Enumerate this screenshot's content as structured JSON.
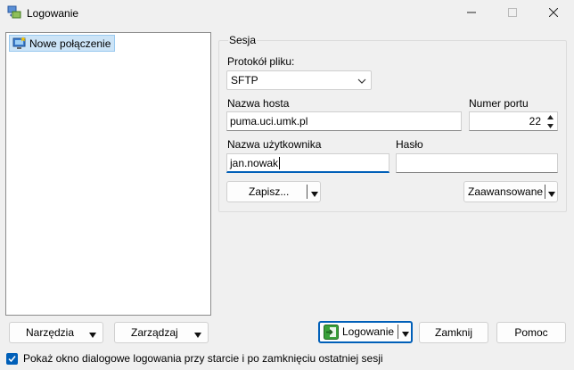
{
  "window": {
    "title": "Logowanie",
    "icon": "winscp-app-icon",
    "controls": [
      "minimize-icon",
      "maximize-icon",
      "close-icon"
    ]
  },
  "sites": {
    "items": [
      {
        "label": "Nowe połączenie",
        "icon": "new-site-computer-icon",
        "selected": true
      }
    ]
  },
  "session": {
    "group_label": "Sesja",
    "protocol": {
      "label": "Protokół pliku:",
      "value": "SFTP"
    },
    "host": {
      "label": "Nazwa hosta",
      "value": "puma.uci.umk.pl"
    },
    "port": {
      "label": "Numer portu",
      "value": "22"
    },
    "user": {
      "label": "Nazwa użytkownika",
      "value": "jan.nowak"
    },
    "password": {
      "label": "Hasło",
      "value": ""
    },
    "save_label": "Zapisz...",
    "advanced_label": "Zaawansowane"
  },
  "buttons": {
    "tools": "Narzędzia",
    "manage": "Zarządzaj",
    "login": "Logowanie",
    "close": "Zamknij",
    "help": "Pomoc"
  },
  "footer": {
    "show_dialog_checked": true,
    "show_dialog_label": "Pokaż okno dialogowe logowania przy starcie i po zamknięciu ostatniej sesji"
  },
  "colors": {
    "accent": "#005fb8",
    "selection": "#cce4f7",
    "login_icon_green": "#3aa13a"
  }
}
